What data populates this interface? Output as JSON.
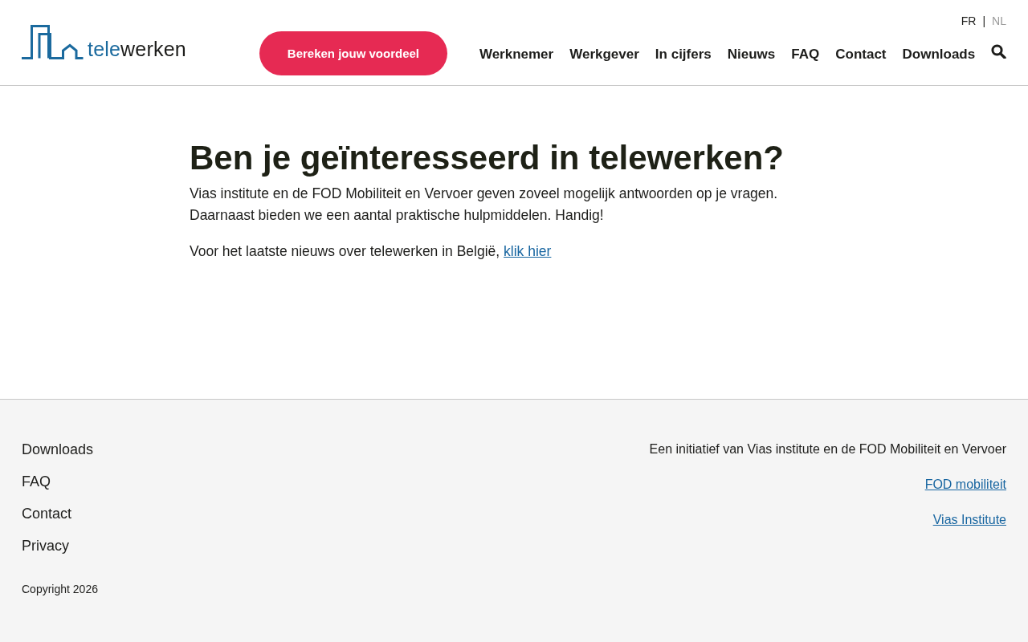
{
  "header": {
    "logo": {
      "part_1": "tele",
      "part_2": "werken"
    },
    "languages": [
      {
        "label": "FR",
        "selected": false
      },
      {
        "label": "NL",
        "selected": true
      }
    ],
    "language_separator": "|",
    "cta_button": "Bereken jouw voordeel",
    "nav": [
      "Werknemer",
      "Werkgever",
      "In cijfers",
      "Nieuws",
      "FAQ",
      "Contact",
      "Downloads"
    ]
  },
  "main": {
    "heading": "Ben je geïnteresseerd in telewerken?",
    "intro": "Vias institute en de FOD Mobiliteit en Vervoer geven zoveel mogelijk antwoorden op je vragen. Daarnaast bieden we een aantal praktische hulpmiddelen. Handig!",
    "news_text": "Voor het laatste nieuws over telewerken in België,",
    "news_link": "klik hier"
  },
  "footer": {
    "links": [
      "Downloads",
      "FAQ",
      "Contact",
      "Privacy"
    ],
    "copyright": "Copyright 2026",
    "initiative": "Een initiatief van Vias institute en de FOD Mobiliteit en Vervoer",
    "partner_links": [
      "FOD mobiliteit",
      "Vias Institute"
    ]
  }
}
